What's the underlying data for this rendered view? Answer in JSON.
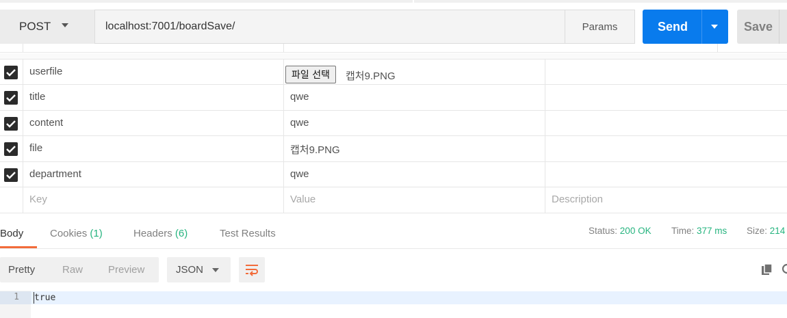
{
  "request": {
    "method": "POST",
    "url": "localhost:7001/boardSave/",
    "params_label": "Params",
    "send_label": "Send",
    "save_label": "Save"
  },
  "form_rows": [
    {
      "key": "userfile",
      "type": "file",
      "file_button": "파일 선택",
      "file_name": "캡처9.PNG",
      "checked": true
    },
    {
      "key": "title",
      "value": "qwe",
      "checked": true
    },
    {
      "key": "content",
      "value": "qwe",
      "checked": true
    },
    {
      "key": "file",
      "value": "캡처9.PNG",
      "checked": true
    },
    {
      "key": "department",
      "value": "qwe",
      "checked": true
    }
  ],
  "new_row": {
    "key_placeholder": "Key",
    "value_placeholder": "Value",
    "description_placeholder": "Description"
  },
  "response_tabs": {
    "body": "Body",
    "cookies": "Cookies",
    "cookies_count": "(1)",
    "headers": "Headers",
    "headers_count": "(6)",
    "test_results": "Test Results"
  },
  "response_status": {
    "status_label": "Status:",
    "status_value": "200 OK",
    "time_label": "Time:",
    "time_value": "377 ms",
    "size_label": "Size:",
    "size_value": "214"
  },
  "view_modes": [
    "Pretty",
    "Raw",
    "Preview"
  ],
  "active_view_mode": "Pretty",
  "format": "JSON",
  "body_lines": [
    {
      "number": "1",
      "text": "true"
    }
  ],
  "colors": {
    "send_blue": "#097bed",
    "status_green": "#26b47f",
    "tab_accent": "#f26b3a"
  },
  "icons": [
    "chevron-down-icon",
    "checkbox-checked-icon",
    "wrap-lines-icon",
    "copy-icon",
    "search-icon"
  ]
}
